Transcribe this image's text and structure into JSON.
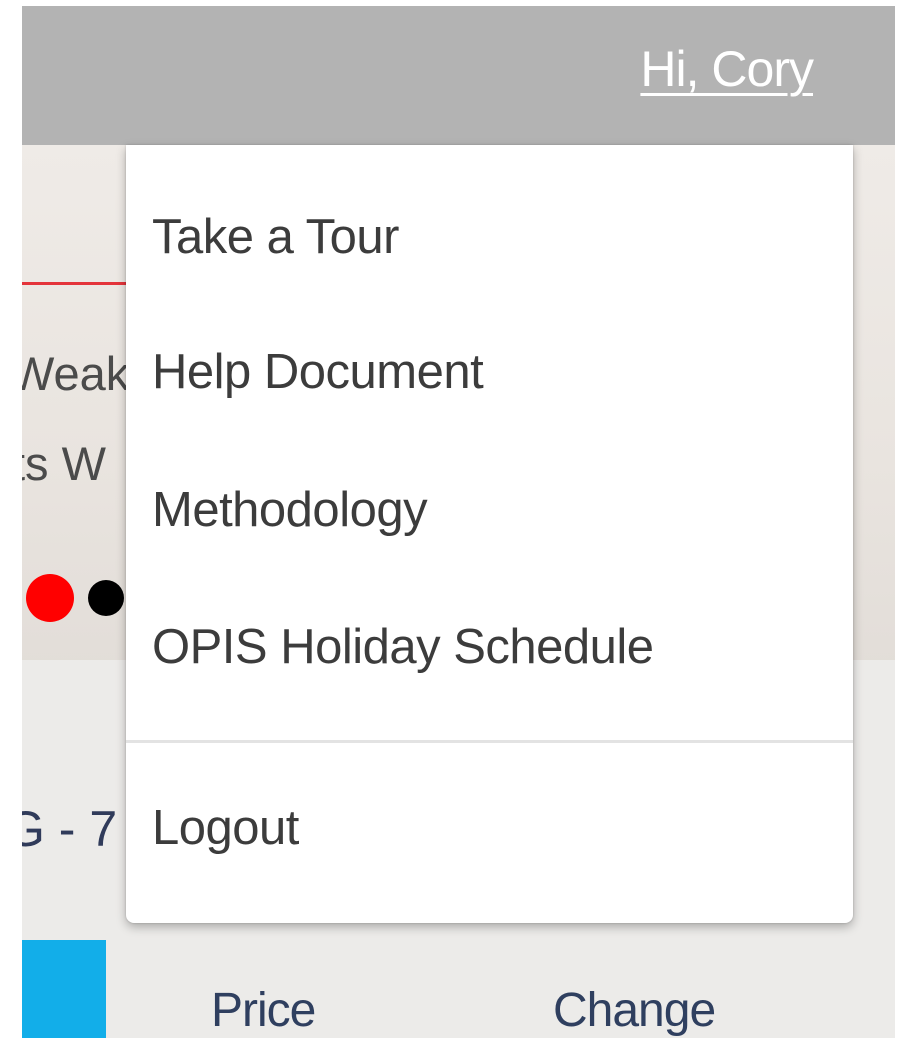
{
  "header": {
    "greeting": "Hi, Cory"
  },
  "background": {
    "headline_line1": "Weak",
    "headline_line2": "ts W",
    "product_code": "G - 7",
    "table_headers": {
      "price": "Price",
      "change": "Change"
    }
  },
  "user_menu": {
    "items": [
      {
        "label": "Take a Tour"
      },
      {
        "label": "Help Document"
      },
      {
        "label": "Methodology"
      },
      {
        "label": "OPIS Holiday Schedule"
      }
    ],
    "logout_label": "Logout"
  },
  "colors": {
    "header_bar": "#b3b3b3",
    "accent_red": "#ff0000",
    "accent_blue": "#12aee9",
    "menu_text": "#3c3c3c"
  }
}
